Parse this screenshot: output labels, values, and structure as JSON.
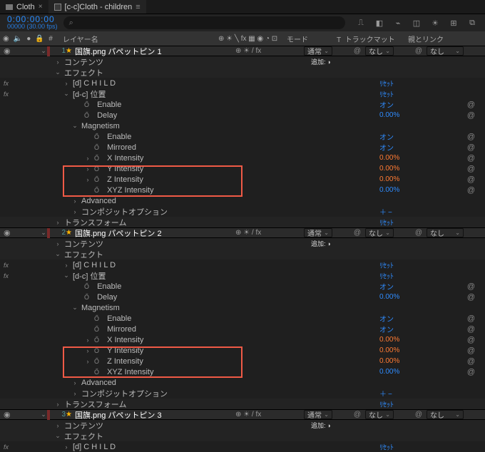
{
  "tabs": {
    "inactive": "Cloth",
    "active": "[c-c]Cloth - children"
  },
  "timecode": {
    "main": "0:00:00:00",
    "sub": "00000 (30.00 fps)"
  },
  "search": {
    "placeholder": ""
  },
  "header": {
    "hash": "#",
    "layerName": "レイヤー名",
    "switches": "⊕ ☀ ╲ fx ▦ ◉ ◔ ⊡",
    "mode": "モード",
    "trackT": "T",
    "trackMatte": "トラックマット",
    "parent": "親とリンク"
  },
  "common": {
    "modeNormal": "通常",
    "noneOpt": "なし",
    "addLabel": "追加:",
    "reset": "ﾘｾｯﾄ",
    "on": "オン",
    "zeroPct": "0.00%",
    "plusMinus": "＋−"
  },
  "layers": [
    {
      "idx": "1",
      "name": "国旗.png パペットピン 1",
      "switches": "⊕ ☀  / fx",
      "groups": {
        "contents": "コンテンツ",
        "effects": "エフェクト",
        "child": "[d] C H I L D",
        "pos": "[d-c] 位置",
        "enable": "Enable",
        "delay": "Delay",
        "magnetism": "Magnetism",
        "m_enable": "Enable",
        "m_mirrored": "Mirrored",
        "xint": "X Intensity",
        "yint": "Y Intensity",
        "zint": "Z Intensity",
        "xyzint": "XYZ Intensity",
        "advanced": "Advanced",
        "compopt": "コンポジットオプション",
        "transform": "トランスフォーム"
      }
    },
    {
      "idx": "2",
      "name": "国旗.png パペットピン 2",
      "switches": "⊕ ☀  / fx",
      "groups": {
        "contents": "コンテンツ",
        "effects": "エフェクト",
        "child": "[d] C H I L D",
        "pos": "[d-c] 位置",
        "enable": "Enable",
        "delay": "Delay",
        "magnetism": "Magnetism",
        "m_enable": "Enable",
        "m_mirrored": "Mirrored",
        "xint": "X Intensity",
        "yint": "Y Intensity",
        "zint": "Z Intensity",
        "xyzint": "XYZ Intensity",
        "advanced": "Advanced",
        "compopt": "コンポジットオプション",
        "transform": "トランスフォーム"
      }
    },
    {
      "idx": "3",
      "name": "国旗.png パペットピン 3",
      "switches": "⊕ ☀  / fx",
      "groups": {
        "contents": "コンテンツ",
        "effects": "エフェクト",
        "child": "[d] C H I L D"
      }
    }
  ]
}
